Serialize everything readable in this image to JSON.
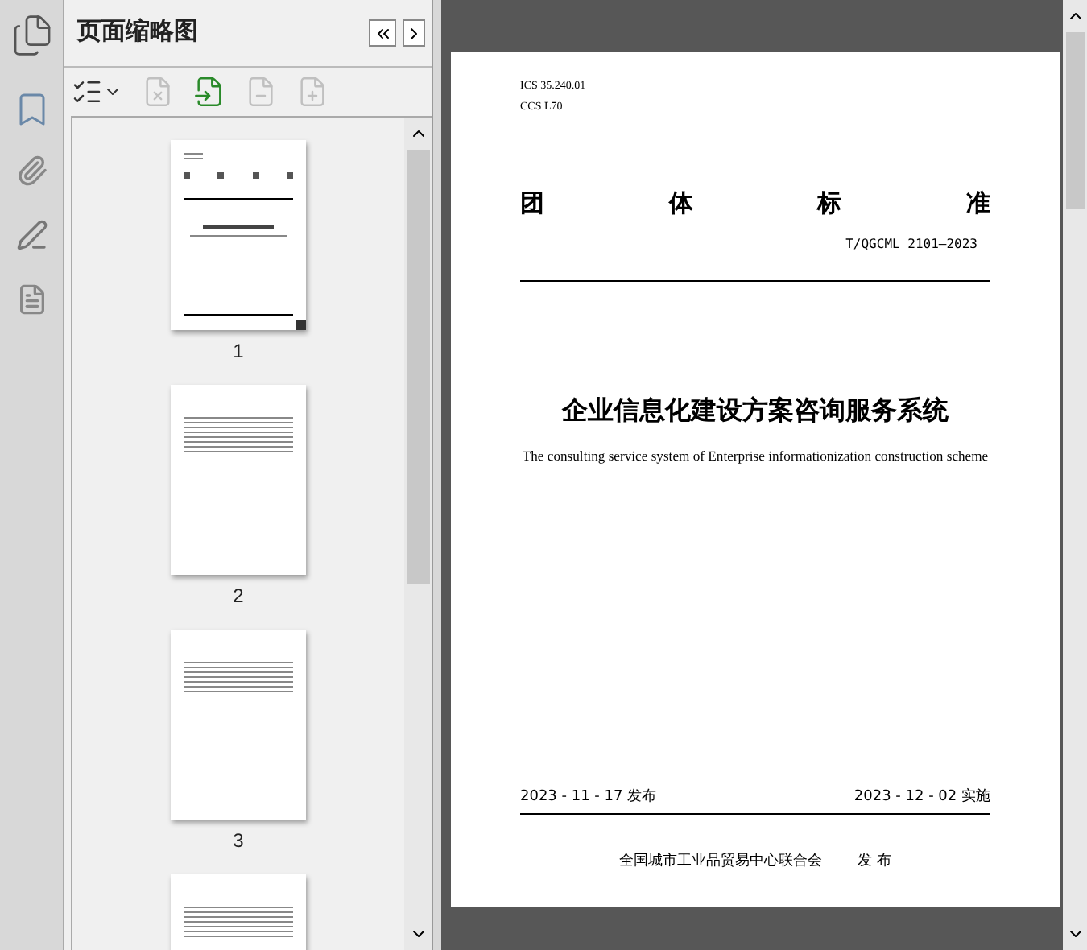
{
  "panel": {
    "title": "页面缩略图"
  },
  "toolbar": [
    {
      "kind": "options",
      "disabled": false
    },
    {
      "kind": "delete",
      "disabled": true
    },
    {
      "kind": "insert",
      "disabled": false
    },
    {
      "kind": "undo",
      "disabled": true
    },
    {
      "kind": "redo",
      "disabled": true
    }
  ],
  "thumbnails": [
    {
      "label": "1",
      "kind": "cover"
    },
    {
      "label": "2",
      "kind": "toc"
    },
    {
      "label": "3",
      "kind": "text"
    },
    {
      "kind": "text"
    }
  ],
  "document": {
    "ics": "ICS 35.240.01",
    "ccs": "CCS L70",
    "heading": [
      "团",
      "体",
      "标",
      "准"
    ],
    "code": "T/QGCML 2101—2023",
    "title": "企业信息化建设方案咨询服务系统",
    "subtitle": "The consulting service system of Enterprise informationization construction scheme",
    "issue_date": "2023 - 11 - 17 发布",
    "effective_date": "2023 - 12 - 02 实施",
    "publisher": "全国城市工业品贸易中心联合会",
    "publish_word": "发 布"
  }
}
